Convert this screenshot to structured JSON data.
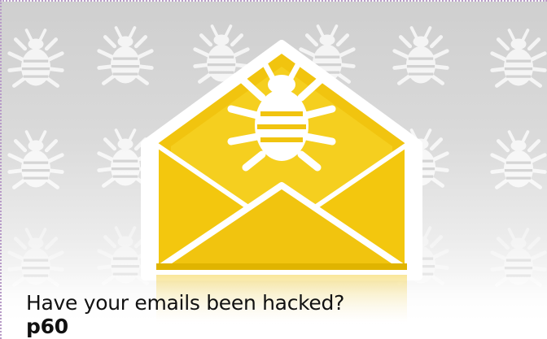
{
  "feature": {
    "headline": "Have your emails been hacked?",
    "page_ref": "p60"
  },
  "icons": {
    "background_pattern": "bug-icon",
    "main_graphic": "open-envelope-with-bug-icon"
  },
  "colors": {
    "envelope_yellow": "#f1c40f",
    "envelope_shadow": "#d8ac00",
    "background_gray": "#d4d4d4",
    "bug_white": "#ffffff",
    "border_dotted": "#b79bc7",
    "text": "#111111"
  }
}
